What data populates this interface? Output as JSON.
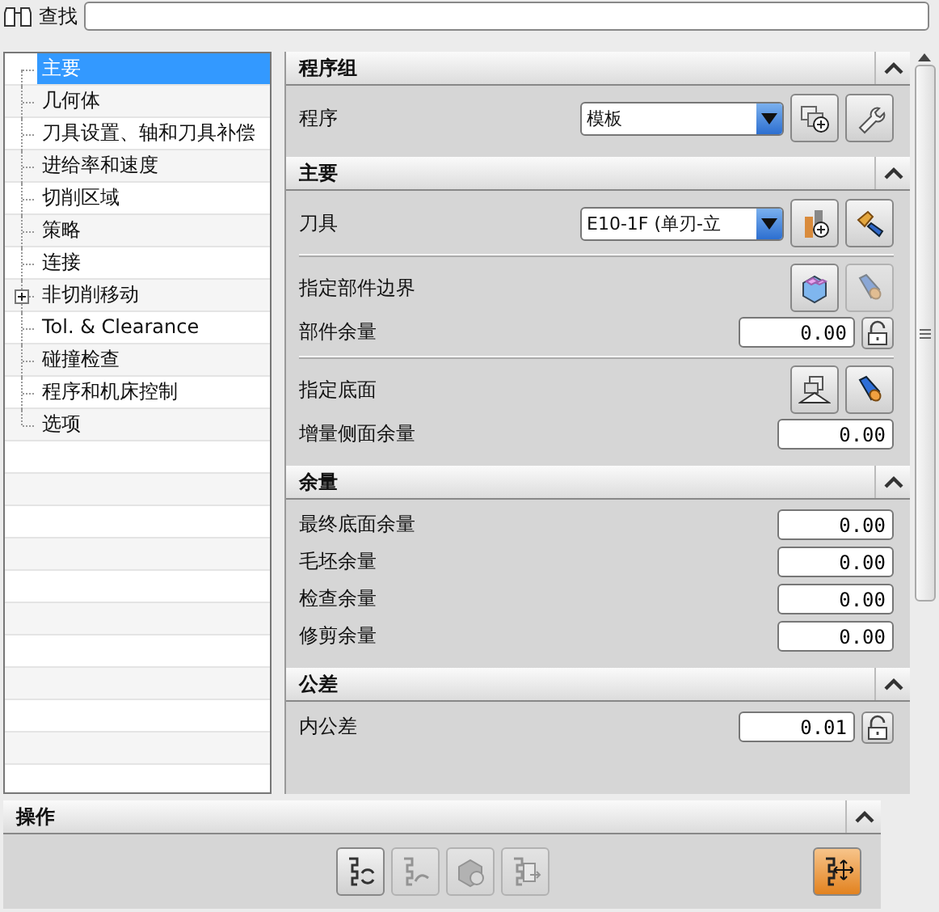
{
  "search": {
    "label": "查找"
  },
  "tree": {
    "items": [
      {
        "label": "主要",
        "selected": true,
        "collapsed": false
      },
      {
        "label": "几何体",
        "selected": false,
        "collapsed": false
      },
      {
        "label": "刀具设置、轴和刀具补偿",
        "selected": false,
        "collapsed": false
      },
      {
        "label": "进给率和速度",
        "selected": false,
        "collapsed": false
      },
      {
        "label": "切削区域",
        "selected": false,
        "collapsed": false
      },
      {
        "label": "策略",
        "selected": false,
        "collapsed": false
      },
      {
        "label": "连接",
        "selected": false,
        "collapsed": false
      },
      {
        "label": "非切削移动",
        "selected": false,
        "collapsed": true
      },
      {
        "label": "Tol. & Clearance",
        "selected": false,
        "collapsed": false
      },
      {
        "label": "碰撞检查",
        "selected": false,
        "collapsed": false
      },
      {
        "label": "程序和机床控制",
        "selected": false,
        "collapsed": false
      },
      {
        "label": "选项",
        "selected": false,
        "collapsed": false
      }
    ]
  },
  "sections": [
    {
      "title": "程序组",
      "expanded": true,
      "rows": [
        {
          "kind": "select",
          "label": "程序",
          "value": "模板",
          "buttons": [
            {
              "disabled": false
            },
            {
              "disabled": false
            }
          ]
        }
      ]
    },
    {
      "title": "主要",
      "expanded": true,
      "rows": [
        {
          "kind": "select",
          "label": "刀具",
          "value": "E10-1F (单刃-立",
          "buttons": [
            {
              "disabled": false
            },
            {
              "disabled": false
            }
          ]
        },
        {
          "kind": "divider"
        },
        {
          "kind": "buttons",
          "label": "指定部件边界",
          "buttons": [
            {
              "disabled": false
            },
            {
              "disabled": true
            }
          ]
        },
        {
          "kind": "number",
          "label": "部件余量",
          "value": "0.00",
          "locked": false
        },
        {
          "kind": "divider"
        },
        {
          "kind": "buttons",
          "label": "指定底面",
          "buttons": [
            {
              "disabled": false
            },
            {
              "disabled": false
            }
          ]
        },
        {
          "kind": "number",
          "label": "增量侧面余量",
          "value": "0.00"
        }
      ]
    },
    {
      "title": "余量",
      "expanded": true,
      "rows": [
        {
          "kind": "number",
          "label": "最终底面余量",
          "value": "0.00"
        },
        {
          "kind": "number",
          "label": "毛坯余量",
          "value": "0.00"
        },
        {
          "kind": "number",
          "label": "检查余量",
          "value": "0.00"
        },
        {
          "kind": "number",
          "label": "修剪余量",
          "value": "0.00"
        }
      ]
    },
    {
      "title": "公差",
      "expanded": true,
      "rows": [
        {
          "kind": "number",
          "label": "内公差",
          "value": "0.01",
          "locked": false
        }
      ]
    }
  ],
  "actions": {
    "title": "操作",
    "expanded": true,
    "buttons": [
      {
        "disabled": false,
        "active": false
      },
      {
        "disabled": true,
        "active": false
      },
      {
        "disabled": true,
        "active": false
      },
      {
        "disabled": true,
        "active": false
      },
      {
        "disabled": false,
        "active": true
      }
    ]
  }
}
